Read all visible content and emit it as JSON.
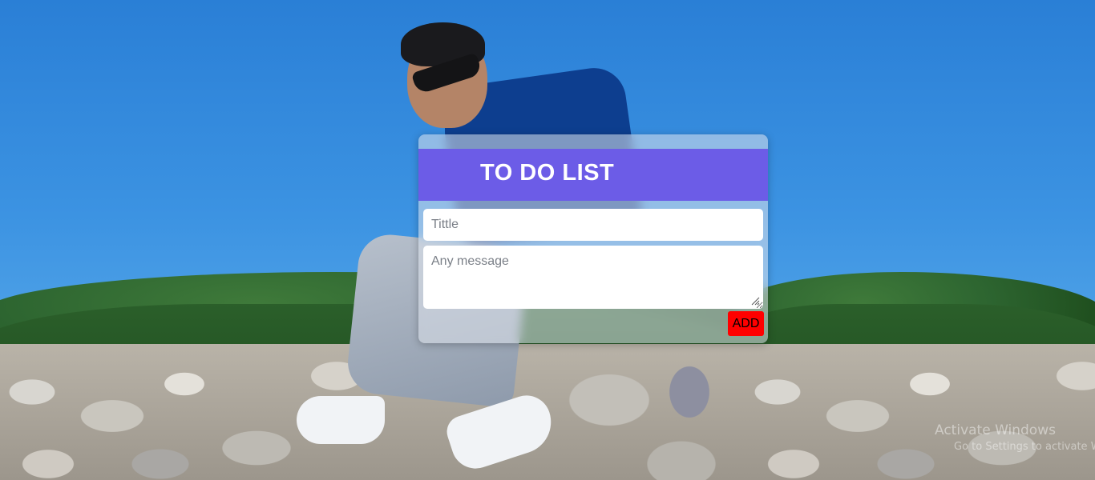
{
  "todo": {
    "title": "TO DO LIST",
    "title_placeholder": "Tittle",
    "message_placeholder": "Any message",
    "add_label": "ADD"
  },
  "watermark": {
    "line1": "Activate Windows",
    "line2": "Go to Settings to activate Windows."
  },
  "colors": {
    "header": "#6c5ce7",
    "add_button": "#ff0000"
  },
  "background": {
    "subject": "photo of a man in a blue shirt and sunglasses sitting on river rocks",
    "tiled": true
  }
}
